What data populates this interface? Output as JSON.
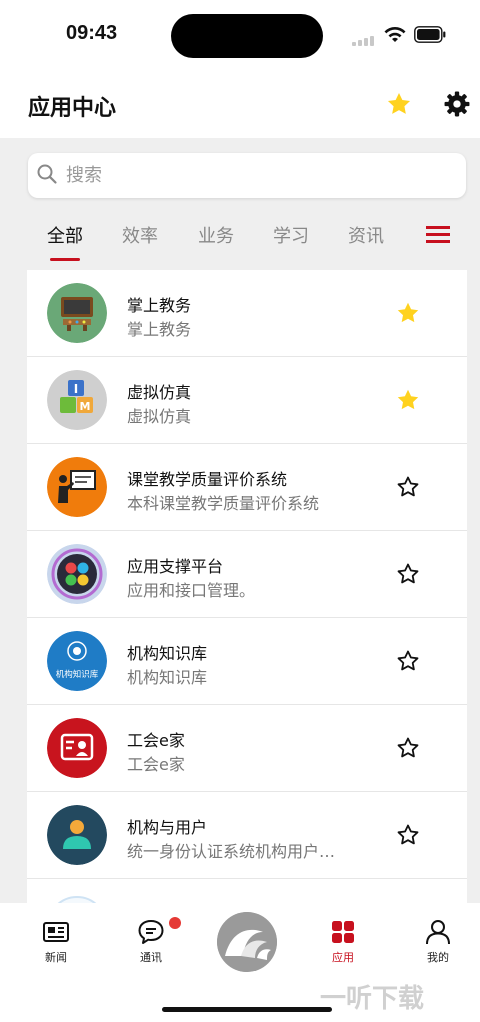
{
  "status_bar": {
    "time": "09:43"
  },
  "header": {
    "title": "应用中心"
  },
  "search": {
    "placeholder": "搜索"
  },
  "tabs": [
    {
      "label": "全部"
    },
    {
      "label": "效率"
    },
    {
      "label": "业务"
    },
    {
      "label": "学习"
    },
    {
      "label": "资讯"
    }
  ],
  "apps": [
    {
      "name": "掌上教务",
      "desc": "掌上教务",
      "favorited": true,
      "icon": "blackboard-icon"
    },
    {
      "name": "虚拟仿真",
      "desc": "虚拟仿真",
      "favorited": true,
      "icon": "blocks-icon"
    },
    {
      "name": "课堂教学质量评价系统",
      "desc": "本科课堂教学质量评价系统",
      "favorited": false,
      "icon": "teacher-icon"
    },
    {
      "name": "应用支撑平台",
      "desc": "应用和接口管理。",
      "favorited": false,
      "icon": "app-grid-icon"
    },
    {
      "name": "机构知识库",
      "desc": "机构知识库",
      "favorited": false,
      "icon": "knowledge-base-icon",
      "icon_text": "机构知识库"
    },
    {
      "name": "工会e家",
      "desc": "工会e家",
      "favorited": false,
      "icon": "id-card-icon"
    },
    {
      "name": "机构与用户",
      "desc": "统一身份认证系统机构用户…",
      "favorited": false,
      "icon": "user-icon"
    }
  ],
  "bottom_nav": {
    "items": [
      {
        "label": "新闻"
      },
      {
        "label": "通讯"
      },
      {
        "label": "应用"
      },
      {
        "label": "我的"
      }
    ],
    "active": "应用"
  },
  "watermark": {
    "text": "一听下载"
  },
  "colors": {
    "accent": "#c7101e",
    "star": "#ffd21f",
    "badge": "#e53935"
  }
}
